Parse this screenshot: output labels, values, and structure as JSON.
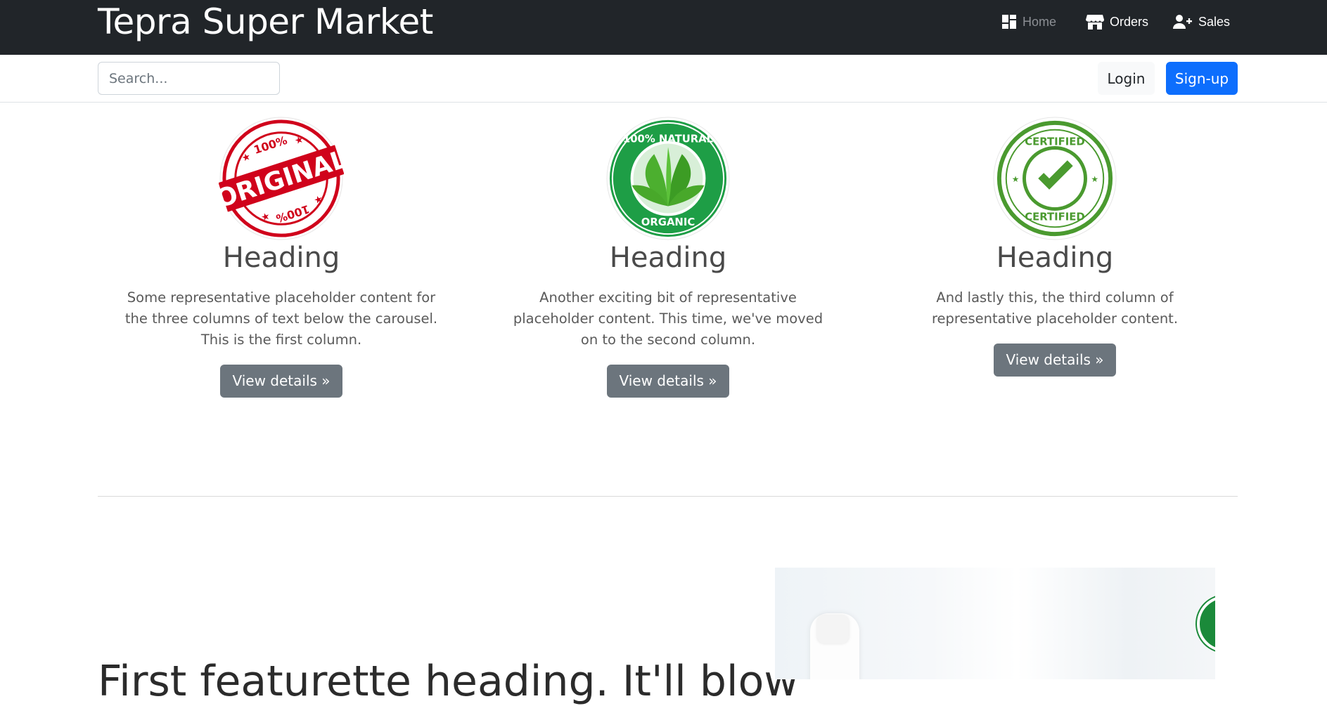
{
  "header": {
    "brand": "Tepra Super Market",
    "nav": [
      {
        "label": "Home",
        "icon": "dashboard-icon"
      },
      {
        "label": "Orders",
        "icon": "store-icon"
      },
      {
        "label": "Sales",
        "icon": "person-add-icon"
      }
    ]
  },
  "toolbar": {
    "search_placeholder": "Search...",
    "login_label": "Login",
    "signup_label": "Sign-up"
  },
  "columns": [
    {
      "image": "original-stamp-badge",
      "heading": "Heading",
      "text": "Some representative placeholder content for the three columns of text below the carousel. This is the first column.",
      "button": "View details »"
    },
    {
      "image": "natural-organic-badge",
      "heading": "Heading",
      "text": "Another exciting bit of representative placeholder content. This time, we've moved on to the second column.",
      "button": "View details »"
    },
    {
      "image": "certified-badge",
      "heading": "Heading",
      "text": "And lastly this, the third column of representative placeholder content.",
      "button": "View details »"
    }
  ],
  "feature": {
    "heading": "First featurette heading. It'll blow"
  },
  "colors": {
    "navbar": "#212529",
    "primary": "#0d6efd",
    "secondary": "#6c757d",
    "original_red": "#d0021b",
    "natural_green": "#1e9e46",
    "certified_green": "#4a9a2f"
  }
}
